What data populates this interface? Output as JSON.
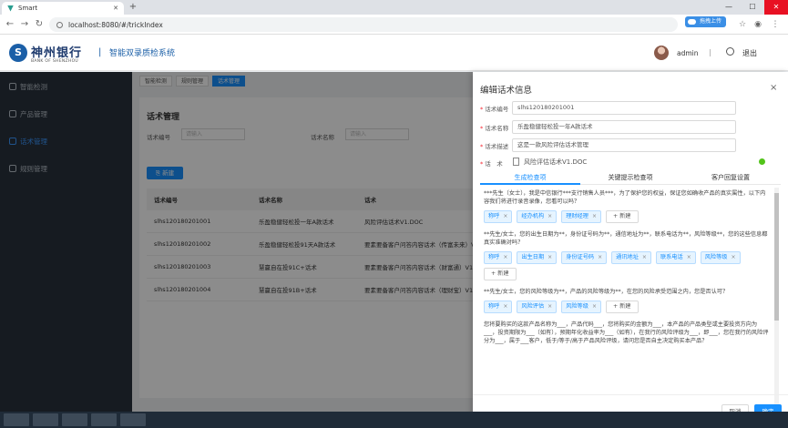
{
  "browser": {
    "tab_title": "Smart",
    "url": "localhost:8080/#/trickIndex",
    "upload_label": "拖拽上传"
  },
  "header": {
    "bank_name_cn": "神州银行",
    "bank_name_en": "BANK OF SHENZHOU",
    "separator": "|",
    "system_title": "智能双录质检系统",
    "user": "admin",
    "logout": "退出"
  },
  "sidebar": {
    "items": [
      {
        "label": "智能检测"
      },
      {
        "label": "产品管理"
      },
      {
        "label": "话术管理"
      },
      {
        "label": "规则管理"
      }
    ]
  },
  "breadcrumbs": [
    "智能检测",
    "规则管理",
    "话术管理"
  ],
  "main": {
    "title": "话术管理",
    "filter_code_label": "话术编号",
    "filter_code_placeholder": "请输入",
    "filter_name_label": "话术名称",
    "filter_name_placeholder": "请输入",
    "new_button": "新建",
    "table": {
      "headers": [
        "话术编号",
        "话术名称",
        "话术"
      ],
      "rows": [
        [
          "slhs120180201001",
          "乐盈稳健轻松投一年A款话术",
          "风险评估话术V1.DOC"
        ],
        [
          "slhs120180201002",
          "乐盈稳健轻松投91天A款话术",
          "要素要备客户问答内容话术（传富未来）V1"
        ],
        [
          "slhs120180201003",
          "慧赢自在投91C+话术",
          "要素要备客户问答内容话术（财富通）V1.8"
        ],
        [
          "slhs120180201004",
          "慧赢自在投91B+话术",
          "要素要备客户问答内容话术（理财宝）V1.8"
        ]
      ]
    }
  },
  "drawer": {
    "title": "编辑话术信息",
    "close": "×",
    "code_label": "话术编号",
    "code_value": "slhs120180201001",
    "name_label": "话术名称",
    "name_value": "乐盈稳健轻松投一年A款话术",
    "desc_label": "话术描述",
    "desc_value": "这是一款风险评估话术管理",
    "file_label": "话　术",
    "file_name": "风险评估话术V1.DOC",
    "tabs": [
      "生成检查项",
      "关键提示检查项",
      "客户回复设置"
    ],
    "paragraphs": [
      {
        "text": "***先生（女士），我是中信银行***支行销售人员***，为了保护您的权益，保证您如确收产品的真实属性，以下内容我们将进行录音录像，您看可以吗？",
        "tags": [
          "称呼",
          "经办机构",
          "理财经理"
        ]
      },
      {
        "text": "**先生/女士，您的出生日期为**，身份证号码为**，通信地址为**，联系电话为**，风险等级**，您的这些信息都真实准确对吗？",
        "tags": [
          "称呼",
          "出生日期",
          "身份证号码",
          "通讯地址",
          "联系电话",
          "风险等级"
        ]
      },
      {
        "text": "**先生/女士，您的风险等级为**，产品的风险等级为**，在您的风险承受范围之内，您是否认可？",
        "tags": [
          "称呼",
          "风险评估",
          "风险等级"
        ]
      },
      {
        "text": "您将要购买的这款产品名称为___，产品代码___，您将购买的金额为___，本产品的产品类型或主要投资方向为___，投资期限为___（如有），预期年化收益率为___（如有），在我行的风险评级为___，即___，您在我行的风险评分为___，属于___客户，低于/等于/高于产品风险评级，请问您是否自主决定购买本产品？",
        "tags": []
      }
    ],
    "add_tag": "+ 新建",
    "tag_close": "×",
    "cancel": "取消",
    "confirm": "确定"
  },
  "colors": {
    "primary": "#1890ff",
    "sidebar_bg": "#28323d",
    "brand_blue": "#1b5fa7",
    "success": "#52c41a"
  }
}
